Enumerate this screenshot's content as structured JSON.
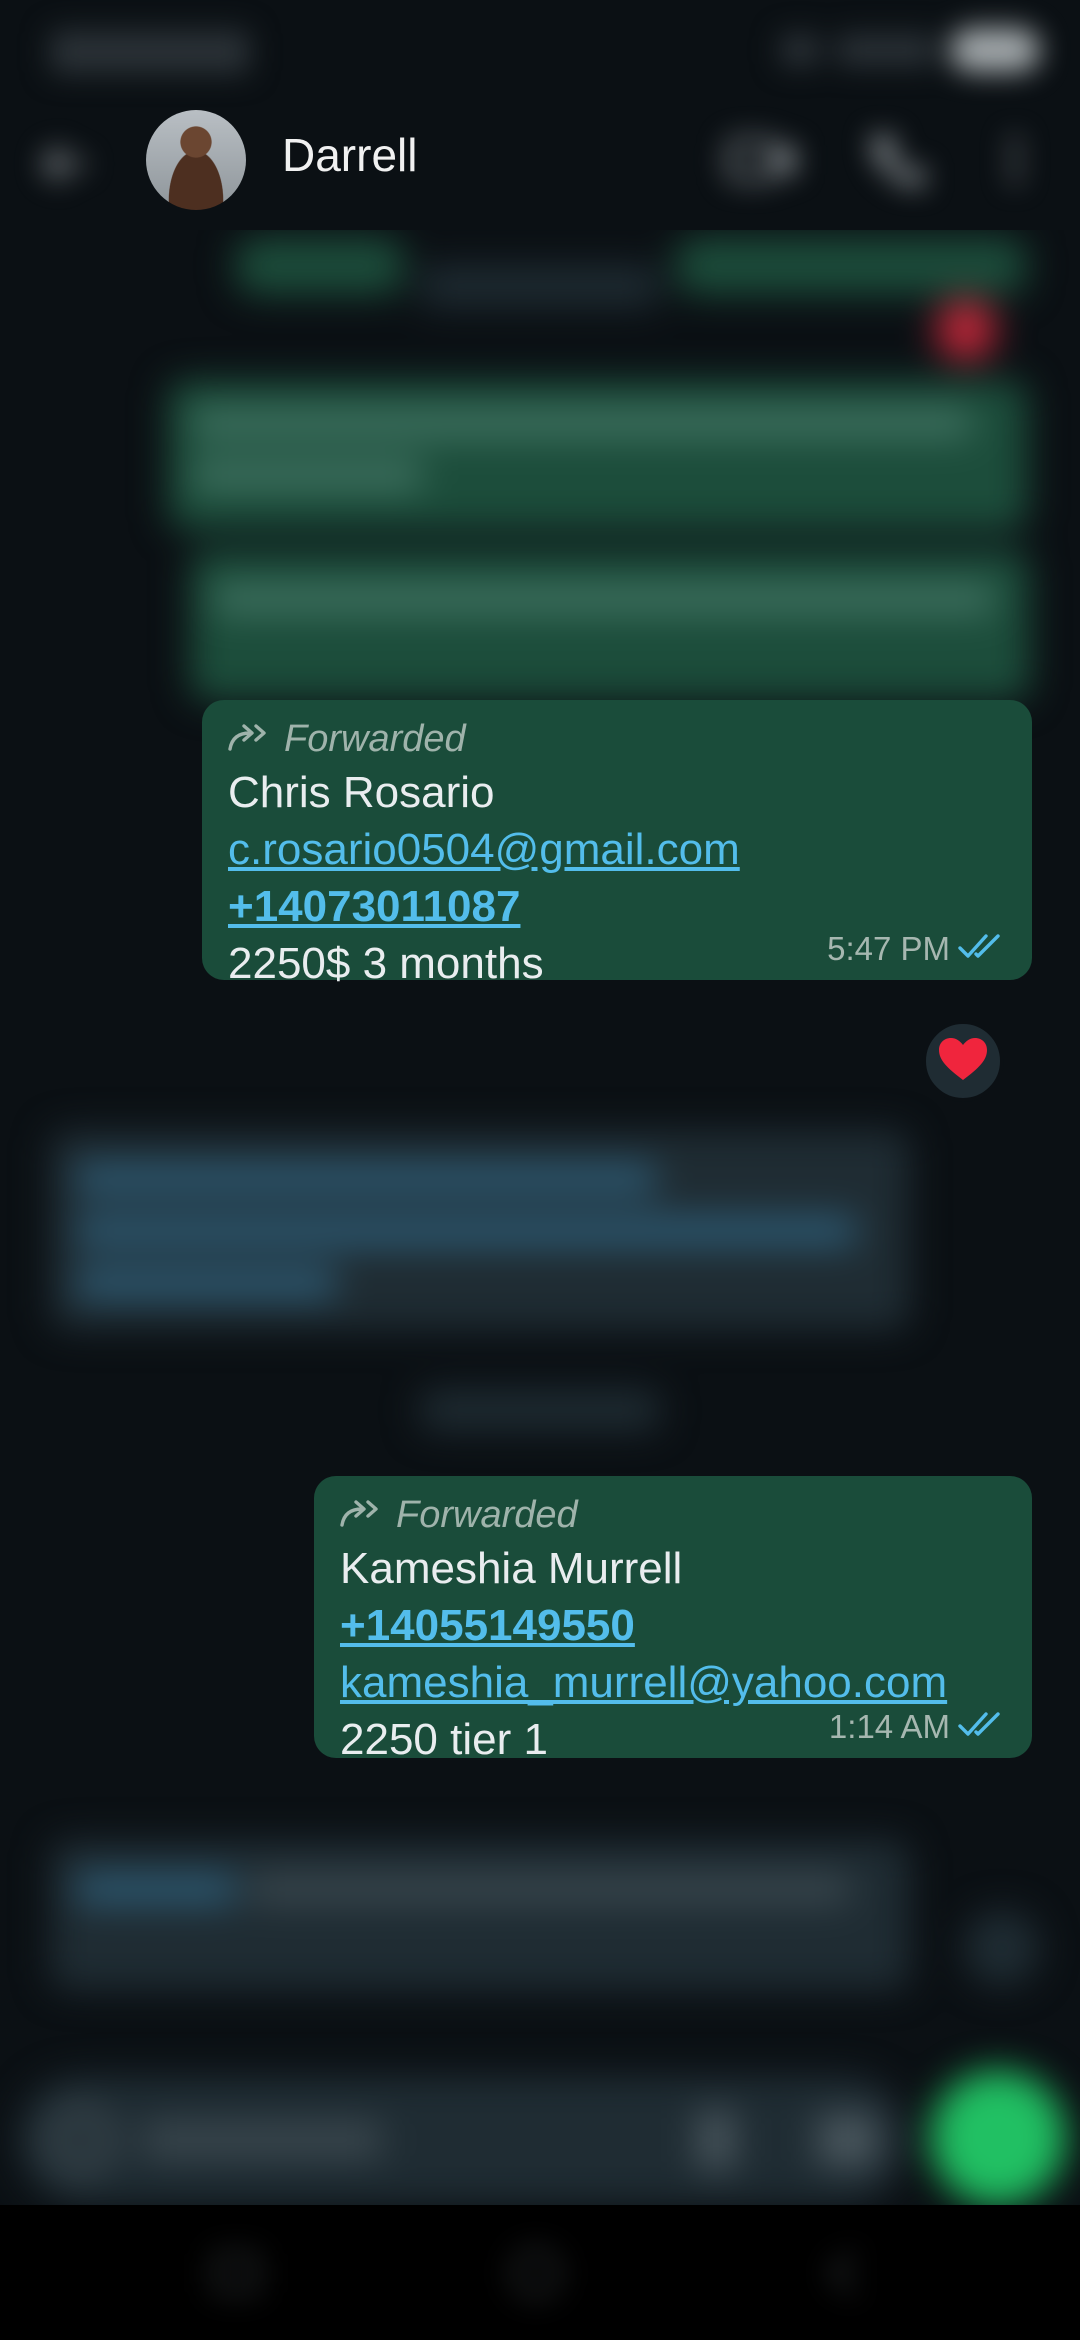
{
  "header": {
    "contact_name": "Darrell",
    "avatar_icon": "contact-photo"
  },
  "messages": [
    {
      "forwarded_label": "Forwarded",
      "lines": [
        "Chris Rosario",
        "c.rosario0504@gmail.com",
        "+14073011087",
        "2250$ 3 months"
      ],
      "time": "5:47 PM",
      "status": "read",
      "reaction": "❤️"
    },
    {
      "forwarded_label": "Forwarded",
      "lines": [
        "Kameshia Murrell",
        "+14055149550",
        "kameshia_murrell@yahoo.com",
        "2250 tier 1"
      ],
      "time": "1:14 AM",
      "status": "read"
    }
  ],
  "colors": {
    "background": "#0b1014",
    "outgoing_bubble": "#1a4c3a",
    "incoming_bubble": "#1f2c33",
    "link": "#53bdeb",
    "read_ticks": "#53bdeb",
    "accent_green": "#21c063"
  }
}
